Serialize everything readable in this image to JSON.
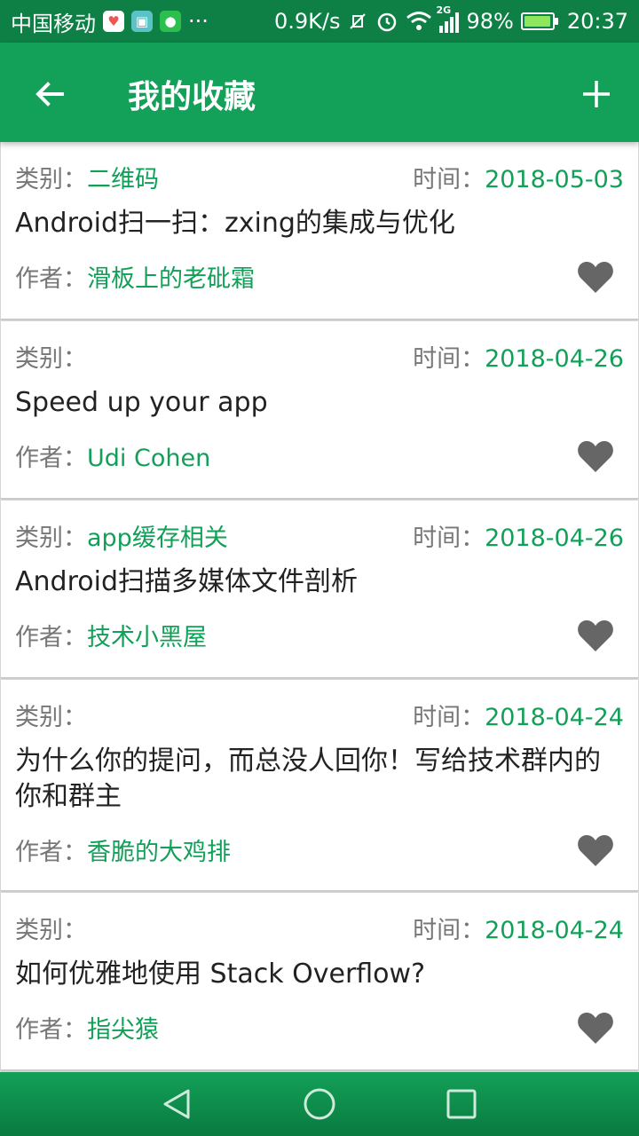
{
  "status": {
    "carrier": "中国移动",
    "network_speed": "0.9K/s",
    "signal_type": "2G",
    "battery": "98%",
    "time": "20:37",
    "more": "···"
  },
  "appbar": {
    "title": "我的收藏",
    "back_icon": "arrow-back-icon",
    "add_icon": "plus-icon"
  },
  "labels": {
    "category": "类别：",
    "time": "时间：",
    "author": "作者："
  },
  "items": [
    {
      "category": "二维码",
      "time": "2018-05-03",
      "title": "Android扫一扫：zxing的集成与优化",
      "author": "滑板上的老砒霜"
    },
    {
      "category": "",
      "time": "2018-04-26",
      "title": "Speed up your app",
      "author": "Udi Cohen"
    },
    {
      "category": "app缓存相关",
      "time": "2018-04-26",
      "title": "Android扫描多媒体文件剖析",
      "author": "技术小黑屋"
    },
    {
      "category": "",
      "time": "2018-04-24",
      "title": "为什么你的提问，而总没人回你！写给技术群内的你和群主",
      "author": "香脆的大鸡排"
    },
    {
      "category": "",
      "time": "2018-04-24",
      "title": "如何优雅地使用 Stack Overflow?",
      "author": "指尖猿"
    }
  ],
  "colors": {
    "primary": "#13a058",
    "primary_dark": "#0e7f45",
    "accent_text": "#12a059",
    "heart": "#666666"
  }
}
